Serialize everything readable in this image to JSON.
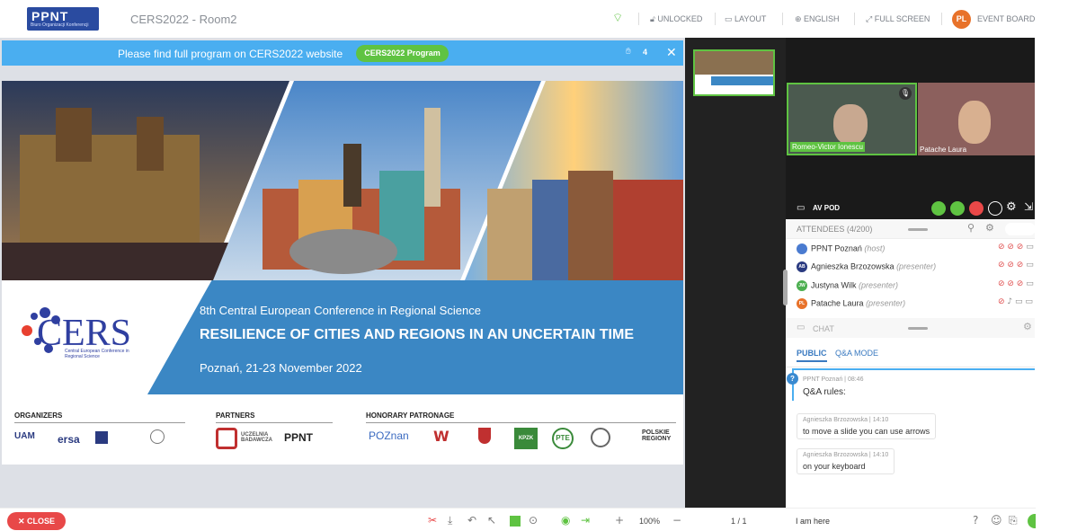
{
  "header": {
    "logo": "PPNT",
    "logo_sub": "Biuro Organizacji Konferencji",
    "room_title": "CERS2022 - Room2",
    "items": [
      "UNLOCKED",
      "LAYOUT",
      "ENGLISH",
      "FULL SCREEN",
      "EVENT BOARD"
    ],
    "avatar_initials": "PL"
  },
  "banner": {
    "text": "Please find full program on CERS2022 website",
    "button": "CERS2022 Program",
    "count": "4",
    "close": "✕"
  },
  "slide": {
    "conf_number": "8th Central European Conference in Regional Science",
    "title": "RESILIENCE OF CITIES AND REGIONS IN AN UNCERTAIN TIME",
    "date": "Poznań, 21-23 November 2022",
    "cers_logo": "CERS",
    "cers_sub": "Central European Conference in Regional Science",
    "sections": {
      "organizers": "ORGANIZERS",
      "partners": "PARTNERS",
      "honorary": "HONORARY PATRONAGE"
    },
    "logos": {
      "uam": "UAM",
      "ersa": "ersa",
      "ppnt": "PPNT",
      "poznan": "POZnan",
      "polskie": "POLSKIE REGIONY",
      "kpzk": "KPZK",
      "pte": "PTE",
      "uczelnia": "UCZELNIA BADAWCZA"
    }
  },
  "video": {
    "p1": "Romeo-Victor Ionescu",
    "p2": "Patache Laura"
  },
  "avpod": "AV POD",
  "attendees": {
    "header": "ATTENDEES (4/200)",
    "list": [
      {
        "name": "PPNT Poznań",
        "role": "(host)",
        "initials": "",
        "color": "#4a7bd0"
      },
      {
        "name": "Agnieszka Brzozowska",
        "role": "(presenter)",
        "initials": "AB",
        "color": "#2a3a80"
      },
      {
        "name": "Justyna Wilk",
        "role": "(presenter)",
        "initials": "JW",
        "color": "#4caf50"
      },
      {
        "name": "Patache Laura",
        "role": "(presenter)",
        "initials": "PL",
        "color": "#e8722a"
      }
    ]
  },
  "chat": {
    "header": "CHAT",
    "tabs": [
      "PUBLIC",
      "Q&A MODE"
    ],
    "messages": [
      {
        "author": "PPNT Poznań",
        "time": "08:46",
        "text": "Q&A rules:"
      },
      {
        "author": "Agnieszka Brzozowska",
        "time": "14:10",
        "text": "to move a slide you can use arrows"
      },
      {
        "author": "Agnieszka Brzozowska",
        "time": "14:10",
        "text": "on your keyboard"
      }
    ],
    "input_value": "I am here"
  },
  "bottom": {
    "close": "CLOSE",
    "zoom": "100%",
    "pages": "1 / 1"
  },
  "colors": {
    "accent": "#5fc342",
    "banner": "#4aaef0",
    "slide_blue": "#3b87c4",
    "close": "#e84848"
  }
}
